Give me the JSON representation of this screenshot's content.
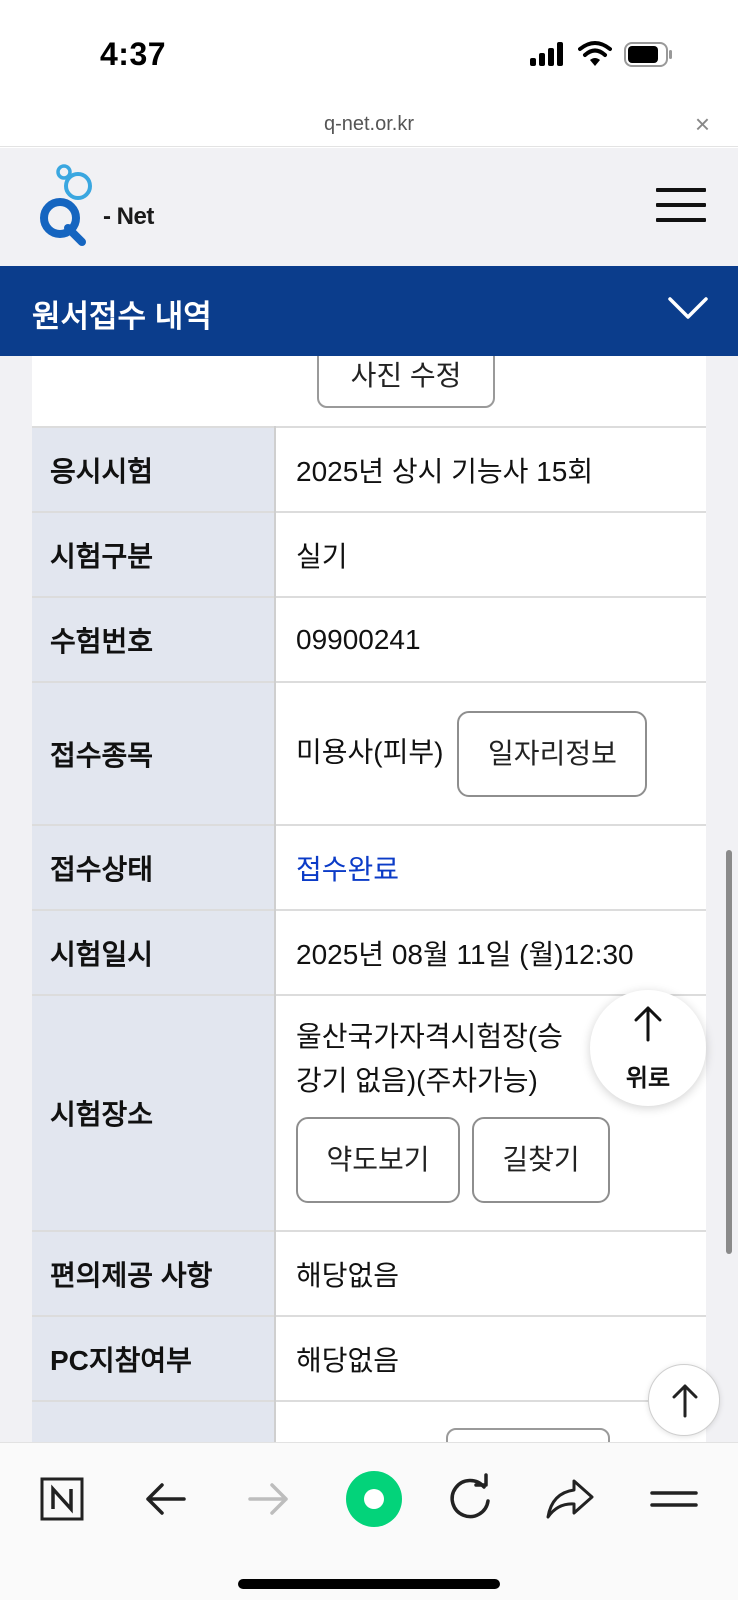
{
  "status_bar": {
    "time": "4:37"
  },
  "browser": {
    "url": "q-net.or.kr",
    "close_glyph": "×"
  },
  "site": {
    "logo_text": "- Net"
  },
  "page": {
    "title": "원서접수 내역"
  },
  "photo_button": "사진 수정",
  "rows": {
    "exam": {
      "label": "응시시험",
      "value": "2025년 상시 기능사 15회"
    },
    "type": {
      "label": "시험구분",
      "value": "실기"
    },
    "number": {
      "label": "수험번호",
      "value": "09900241"
    },
    "subject": {
      "label": "접수종목",
      "value": "미용사(피부)",
      "button": "일자리정보"
    },
    "status": {
      "label": "접수상태",
      "value": "접수완료"
    },
    "datetime": {
      "label": "시험일시",
      "value": "2025년 08월 11일 (월)12:30"
    },
    "place": {
      "label": "시험장소",
      "value": "울산국가자격시험장(승강기 없음)(주차가능)",
      "map_button": "약도보기",
      "route_button": "길찾기"
    },
    "convenience": {
      "label": "편의제공 사항",
      "value": "해당없음"
    },
    "pc": {
      "label": "PC지참여부",
      "value": "해당없음"
    }
  },
  "float_top": {
    "label": "위로"
  },
  "colors": {
    "header_blue": "#0b3d8c",
    "status_blue": "#0b3bc7",
    "label_bg": "#e2e6ef",
    "naver_green": "#03d37a"
  },
  "toolbar_icons": [
    "naver-n-icon",
    "back-arrow-icon",
    "forward-arrow-icon",
    "green-dot-icon",
    "refresh-icon",
    "share-icon",
    "menu-icon"
  ]
}
